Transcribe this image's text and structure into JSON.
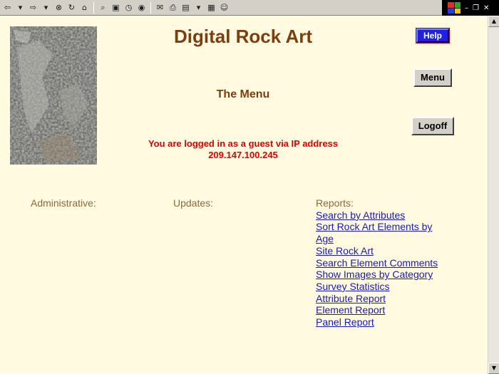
{
  "browser": {
    "toolbar_icons": [
      "back-icon",
      "forward-icon",
      "stop-icon",
      "refresh-icon",
      "home-icon",
      "search-icon",
      "favorites-icon",
      "history-icon",
      "media-icon",
      "mail-icon",
      "print-icon",
      "edit-icon",
      "discuss-icon",
      "messenger-icon"
    ],
    "window_controls": {
      "minimize": "–",
      "restore": "❐",
      "close": "✕"
    }
  },
  "page": {
    "title": "Digital Rock Art",
    "subtitle": "The Menu",
    "login_message": "You are logged in as a guest via IP address 209.147.100.245",
    "help_label": "Help",
    "menu_label": "Menu",
    "logoff_label": "Logoff"
  },
  "sections": {
    "administrative": "Administrative:",
    "updates": "Updates:",
    "reports_label": "Reports:",
    "reports": [
      "Search by Attributes",
      "Sort Rock Art Elements by Age",
      "Site Rock Art",
      "Search Element Comments",
      "Show Images by Category",
      "Survey Statistics",
      "Attribute Report",
      "Element Report",
      "Panel Report"
    ]
  },
  "colors": {
    "background": "#fffae0",
    "title": "#7b3e10",
    "alert": "#e00000",
    "link": "#1a1ab8",
    "label": "#8a6a3a"
  }
}
